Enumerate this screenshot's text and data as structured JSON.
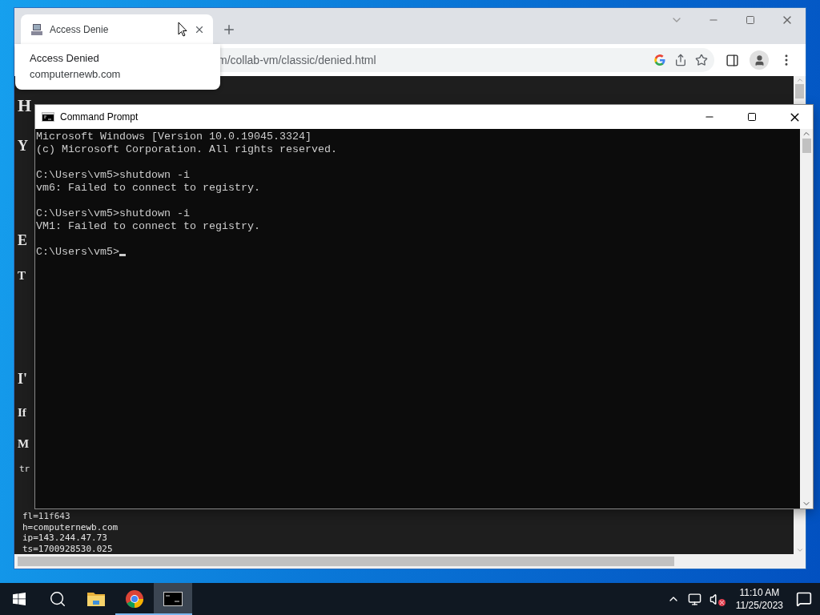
{
  "browser": {
    "tabs": [
      {
        "title": "Access Denie",
        "selected": true
      }
    ],
    "hover_card": {
      "title": "Access Denied",
      "domain": "computernewb.com"
    },
    "address_bar": {
      "url": "m/collab-vm/classic/denied.html"
    },
    "page": {
      "items": [
        {
          "kind": "h1",
          "text": "H"
        },
        {
          "kind": "h2",
          "text": "Y"
        },
        {
          "kind": "h2",
          "text": "E"
        },
        {
          "kind": "h3",
          "text": "T"
        },
        {
          "kind": "h2",
          "text": "I'"
        },
        {
          "kind": "h3",
          "text": "If"
        },
        {
          "kind": "h3",
          "text": "M"
        },
        {
          "kind": "mono",
          "text": "tr"
        }
      ],
      "footer_lines": [
        "fl=11f643",
        "h=computernewb.com",
        "ip=143.244.47.73",
        "ts=1700928530.025"
      ]
    }
  },
  "console_window": {
    "title": "Command Prompt",
    "blocks": [
      [
        "Microsoft Windows [Version 10.0.19045.3324]",
        "(c) Microsoft Corporation. All rights reserved."
      ],
      [
        "C:\\Users\\vm5>shutdown -i",
        "vm6: Failed to connect to registry."
      ],
      [
        "C:\\Users\\vm5>shutdown -i",
        "VM1: Failed to connect to registry."
      ]
    ],
    "prompt": "C:\\Users\\vm5>"
  },
  "taskbar": {
    "apps": [
      {
        "kind": "start",
        "running": false,
        "selected": false
      },
      {
        "kind": "search",
        "running": false,
        "selected": false
      },
      {
        "kind": "explorer",
        "running": false,
        "selected": false
      },
      {
        "kind": "chrome",
        "running": true,
        "selected": false
      },
      {
        "kind": "terminal",
        "running": true,
        "selected": true
      }
    ],
    "time": "11:10 AM",
    "date": "11/25/2023"
  }
}
